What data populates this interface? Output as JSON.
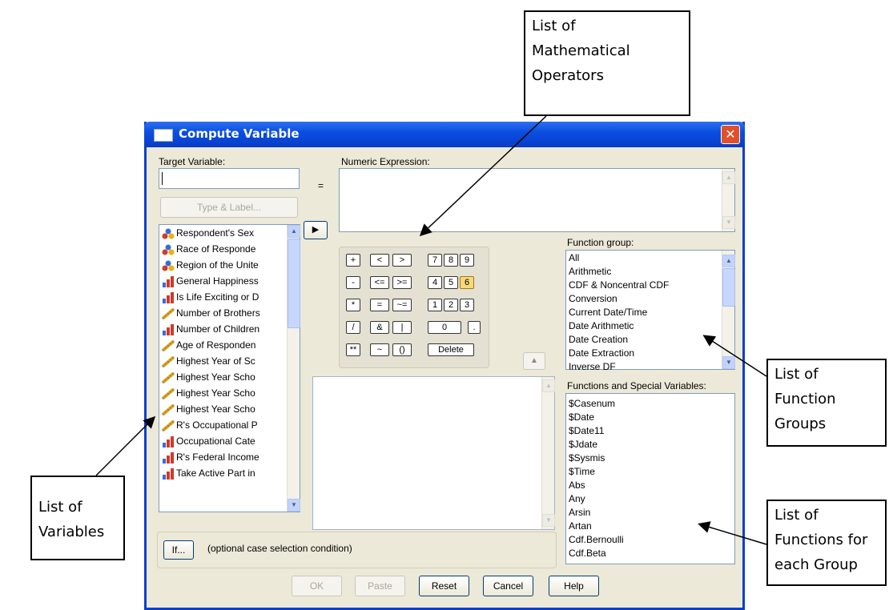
{
  "annotations": {
    "operators": [
      "List of",
      "Mathematical",
      "Operators"
    ],
    "groups": [
      "List of",
      "Function",
      "Groups"
    ],
    "functions": [
      "List of",
      "Functions for",
      "each Group"
    ],
    "variables": [
      "List of",
      "Variables"
    ]
  },
  "dialog": {
    "title": "Compute Variable",
    "close_icon": "close-icon",
    "target_label": "Target Variable:",
    "target_value": "",
    "equals": "=",
    "numeric_label": "Numeric Expression:",
    "type_label_button": "Type & Label...",
    "move_arrow": "▶",
    "variables": [
      {
        "label": "Respondent's Sex",
        "icon": "nominal-icon"
      },
      {
        "label": "Race of Responde",
        "icon": "nominal-icon"
      },
      {
        "label": "Region of the Unite",
        "icon": "nominal-icon"
      },
      {
        "label": "General Happiness",
        "icon": "ordinal-icon"
      },
      {
        "label": "Is Life Exciting or D",
        "icon": "ordinal-icon"
      },
      {
        "label": "Number of Brothers",
        "icon": "scale-icon"
      },
      {
        "label": "Number of Children",
        "icon": "ordinal-icon"
      },
      {
        "label": "Age of Responden",
        "icon": "scale-icon"
      },
      {
        "label": "Highest Year of Sc",
        "icon": "scale-icon"
      },
      {
        "label": "Highest Year Scho",
        "icon": "scale-icon"
      },
      {
        "label": "Highest Year Scho",
        "icon": "scale-icon"
      },
      {
        "label": "Highest Year Scho",
        "icon": "scale-icon"
      },
      {
        "label": "R's Occupational P",
        "icon": "scale-icon"
      },
      {
        "label": "Occupational Cate",
        "icon": "ordinal-icon"
      },
      {
        "label": "R's Federal Income",
        "icon": "ordinal-icon"
      },
      {
        "label": "Take Active Part in",
        "icon": "ordinal-icon"
      }
    ],
    "keypad": {
      "row1": [
        "+",
        "<",
        ">",
        "7",
        "8",
        "9"
      ],
      "row2": [
        "-",
        "<=",
        ">=",
        "4",
        "5",
        "6"
      ],
      "row3": [
        "*",
        "=",
        "~=",
        "1",
        "2",
        "3"
      ],
      "row4": [
        "/",
        "&",
        "|",
        "0",
        "."
      ],
      "row5": [
        "**",
        "~",
        "()",
        "Delete"
      ]
    },
    "function_group_label": "Function group:",
    "function_groups": [
      "All",
      "Arithmetic",
      "CDF & Noncentral CDF",
      "Conversion",
      "Current Date/Time",
      "Date Arithmetic",
      "Date Creation",
      "Date Extraction",
      "Inverse DF"
    ],
    "functions_label": "Functions and Special Variables:",
    "functions": [
      "$Casenum",
      "$Date",
      "$Date11",
      "$Jdate",
      "$Sysmis",
      "$Time",
      "Abs",
      "Any",
      "Arsin",
      "Artan",
      "Cdf.Bernoulli",
      "Cdf.Beta"
    ],
    "if_button": "If...",
    "if_text": "(optional case selection condition)",
    "buttons": {
      "ok": "OK",
      "paste": "Paste",
      "reset": "Reset",
      "cancel": "Cancel",
      "help": "Help"
    }
  }
}
